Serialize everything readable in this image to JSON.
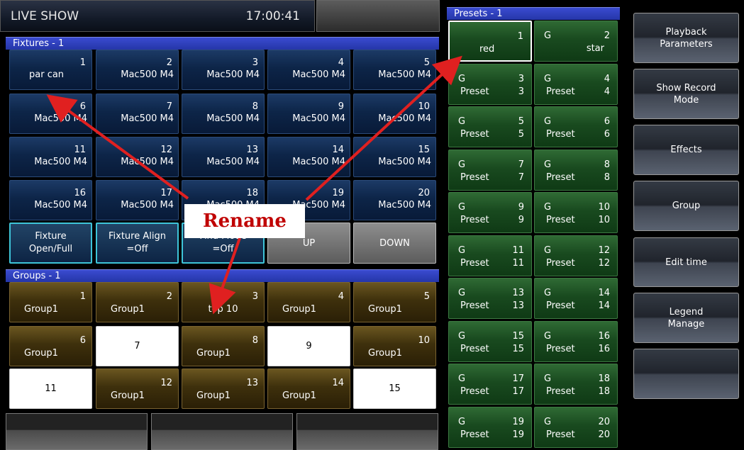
{
  "header": {
    "title": "LIVE SHOW",
    "time": "17:00:41"
  },
  "fixtures": {
    "title": "Fixtures - 1",
    "cells": [
      {
        "num": "1",
        "name": "par can"
      },
      {
        "num": "2",
        "name": "Mac500 M4"
      },
      {
        "num": "3",
        "name": "Mac500 M4"
      },
      {
        "num": "4",
        "name": "Mac500 M4"
      },
      {
        "num": "5",
        "name": "Mac500 M4"
      },
      {
        "num": "6",
        "name": "Mac500 M4"
      },
      {
        "num": "7",
        "name": "Mac500 M4"
      },
      {
        "num": "8",
        "name": "Mac500 M4"
      },
      {
        "num": "9",
        "name": "Mac500 M4"
      },
      {
        "num": "10",
        "name": "Mac500 M4"
      },
      {
        "num": "11",
        "name": "Mac500 M4"
      },
      {
        "num": "12",
        "name": "Mac500 M4"
      },
      {
        "num": "13",
        "name": "Mac500 M4"
      },
      {
        "num": "14",
        "name": "Mac500 M4"
      },
      {
        "num": "15",
        "name": "Mac500 M4"
      },
      {
        "num": "16",
        "name": "Mac500 M4"
      },
      {
        "num": "17",
        "name": "Mac500 M4"
      },
      {
        "num": "18",
        "name": "Mac500 M4"
      },
      {
        "num": "19",
        "name": "Mac500 M4"
      },
      {
        "num": "20",
        "name": "Mac500 M4"
      }
    ],
    "buttons": [
      {
        "line1": "Fixture",
        "line2": "Open/Full"
      },
      {
        "line1": "Fixture Align",
        "line2": "=Off"
      },
      {
        "line1": "Find Mode",
        "line2": "=Off"
      },
      {
        "line1": "UP",
        "line2": ""
      },
      {
        "line1": "DOWN",
        "line2": ""
      }
    ]
  },
  "groups": {
    "title": "Groups - 1",
    "cells": [
      {
        "num": "1",
        "name": "Group1"
      },
      {
        "num": "2",
        "name": "Group1"
      },
      {
        "num": "3",
        "name": "top 10"
      },
      {
        "num": "4",
        "name": "Group1"
      },
      {
        "num": "5",
        "name": "Group1"
      },
      {
        "num": "6",
        "name": "Group1"
      },
      {
        "num": "7",
        "name": ""
      },
      {
        "num": "8",
        "name": "Group1"
      },
      {
        "num": "9",
        "name": ""
      },
      {
        "num": "10",
        "name": "Group1"
      },
      {
        "num": "11",
        "name": ""
      },
      {
        "num": "12",
        "name": "Group1"
      },
      {
        "num": "13",
        "name": "Group1"
      },
      {
        "num": "14",
        "name": "Group1"
      },
      {
        "num": "15",
        "name": ""
      }
    ]
  },
  "presets": {
    "title": "Presets - 1",
    "cells": [
      {
        "g": "",
        "num": "1",
        "name": "red",
        "pnum": ""
      },
      {
        "g": "G",
        "num": "2",
        "name": "star",
        "pnum": ""
      },
      {
        "g": "G",
        "num": "3",
        "name": "Preset",
        "pnum": "3"
      },
      {
        "g": "G",
        "num": "4",
        "name": "Preset",
        "pnum": "4"
      },
      {
        "g": "G",
        "num": "5",
        "name": "Preset",
        "pnum": "5"
      },
      {
        "g": "G",
        "num": "6",
        "name": "Preset",
        "pnum": "6"
      },
      {
        "g": "G",
        "num": "7",
        "name": "Preset",
        "pnum": "7"
      },
      {
        "g": "G",
        "num": "8",
        "name": "Preset",
        "pnum": "8"
      },
      {
        "g": "G",
        "num": "9",
        "name": "Preset",
        "pnum": "9"
      },
      {
        "g": "G",
        "num": "10",
        "name": "Preset",
        "pnum": "10"
      },
      {
        "g": "G",
        "num": "11",
        "name": "Preset",
        "pnum": "11"
      },
      {
        "g": "G",
        "num": "12",
        "name": "Preset",
        "pnum": "12"
      },
      {
        "g": "G",
        "num": "13",
        "name": "Preset",
        "pnum": "13"
      },
      {
        "g": "G",
        "num": "14",
        "name": "Preset",
        "pnum": "14"
      },
      {
        "g": "G",
        "num": "15",
        "name": "Preset",
        "pnum": "15"
      },
      {
        "g": "G",
        "num": "16",
        "name": "Preset",
        "pnum": "16"
      },
      {
        "g": "G",
        "num": "17",
        "name": "Preset",
        "pnum": "17"
      },
      {
        "g": "G",
        "num": "18",
        "name": "Preset",
        "pnum": "18"
      },
      {
        "g": "G",
        "num": "19",
        "name": "Preset",
        "pnum": "19"
      },
      {
        "g": "G",
        "num": "20",
        "name": "Preset",
        "pnum": "20"
      }
    ]
  },
  "sidebar": {
    "buttons": [
      {
        "line1": "Playback",
        "line2": "Parameters"
      },
      {
        "line1": "Show Record",
        "line2": "Mode"
      },
      {
        "line1": "Effects",
        "line2": ""
      },
      {
        "line1": "Group",
        "line2": ""
      },
      {
        "line1": "Edit time",
        "line2": ""
      },
      {
        "line1": "Legend",
        "line2": "Manage"
      },
      {
        "line1": "",
        "line2": ""
      }
    ]
  },
  "annotation": {
    "label": "Rename",
    "color": "#e02020"
  }
}
